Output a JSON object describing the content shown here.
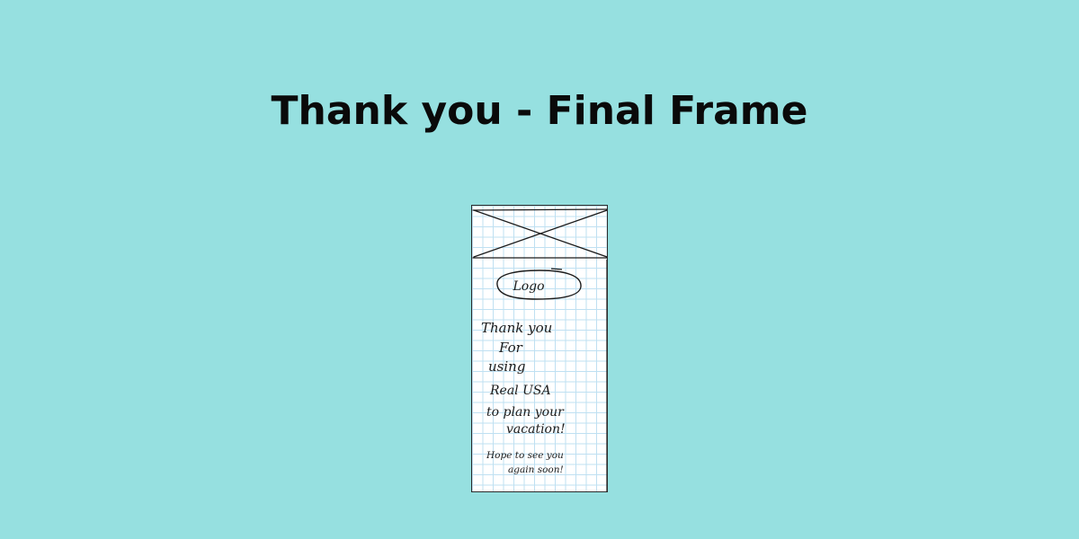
{
  "title": "Thank you - Final Frame",
  "sketch": {
    "logo_label": "Logo",
    "message_lines": [
      "Thank you",
      "For",
      "using",
      "Real USA",
      "to plan your",
      "vacation!"
    ],
    "footer_lines": [
      "Hope to see you",
      "again soon!"
    ]
  }
}
